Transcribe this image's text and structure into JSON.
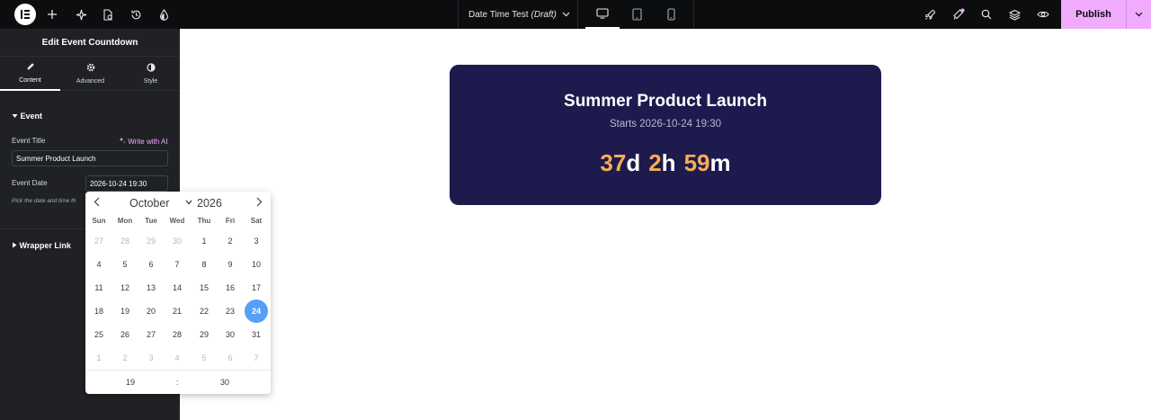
{
  "topbar": {
    "doc_title": "Date Time Test",
    "doc_status": "(Draft)",
    "publish_label": "Publish",
    "icons": [
      "elementor-logo-icon",
      "add-icon",
      "ai-sparkle-icon",
      "page-settings-icon",
      "history-icon",
      "theme-style-icon",
      "rocket-icon",
      "notifications-icon",
      "search-icon",
      "structure-layers-icon",
      "preview-eye-icon"
    ],
    "notification_dot_color": "#f0abfc"
  },
  "panel": {
    "title": "Edit Event Countdown",
    "tabs": [
      {
        "label": "Content",
        "icon": "pencil-icon"
      },
      {
        "label": "Advanced",
        "icon": "gear-icon"
      },
      {
        "label": "Style",
        "icon": "half-circle-icon"
      }
    ],
    "section_event": "Event",
    "event_title_label": "Event Title",
    "write_ai_label": "Write with AI",
    "event_title_value": "Summer Product Launch",
    "event_date_label": "Event Date",
    "event_date_value": "2026-10-24 19:30",
    "event_date_hint": "Pick the date and time th",
    "section_wrapper": "Wrapper Link"
  },
  "calendar": {
    "month": "October",
    "year": "2026",
    "weekdays": [
      "Sun",
      "Mon",
      "Tue",
      "Wed",
      "Thu",
      "Fri",
      "Sat"
    ],
    "weeks": [
      [
        "27",
        "28",
        "29",
        "30",
        "1",
        "2",
        "3"
      ],
      [
        "4",
        "5",
        "6",
        "7",
        "8",
        "9",
        "10"
      ],
      [
        "11",
        "12",
        "13",
        "14",
        "15",
        "16",
        "17"
      ],
      [
        "18",
        "19",
        "20",
        "21",
        "22",
        "23",
        "24"
      ],
      [
        "25",
        "26",
        "27",
        "28",
        "29",
        "30",
        "31"
      ],
      [
        "1",
        "2",
        "3",
        "4",
        "5",
        "6",
        "7"
      ]
    ],
    "muted_first_week_count": 4,
    "muted_last_week": true,
    "selected_day": "24",
    "selected_color": "#569ff7",
    "time_hour": "19",
    "time_sep": ":",
    "time_minute": "30"
  },
  "card": {
    "title": "Summer Product Launch",
    "subtitle": "Starts 2026-10-24 19:30",
    "days": "37",
    "days_unit": "d",
    "hours": "2",
    "hours_unit": "h",
    "minutes": "59",
    "minutes_unit": "m",
    "background": "#1e1a4d",
    "number_color": "#f6ad55"
  }
}
